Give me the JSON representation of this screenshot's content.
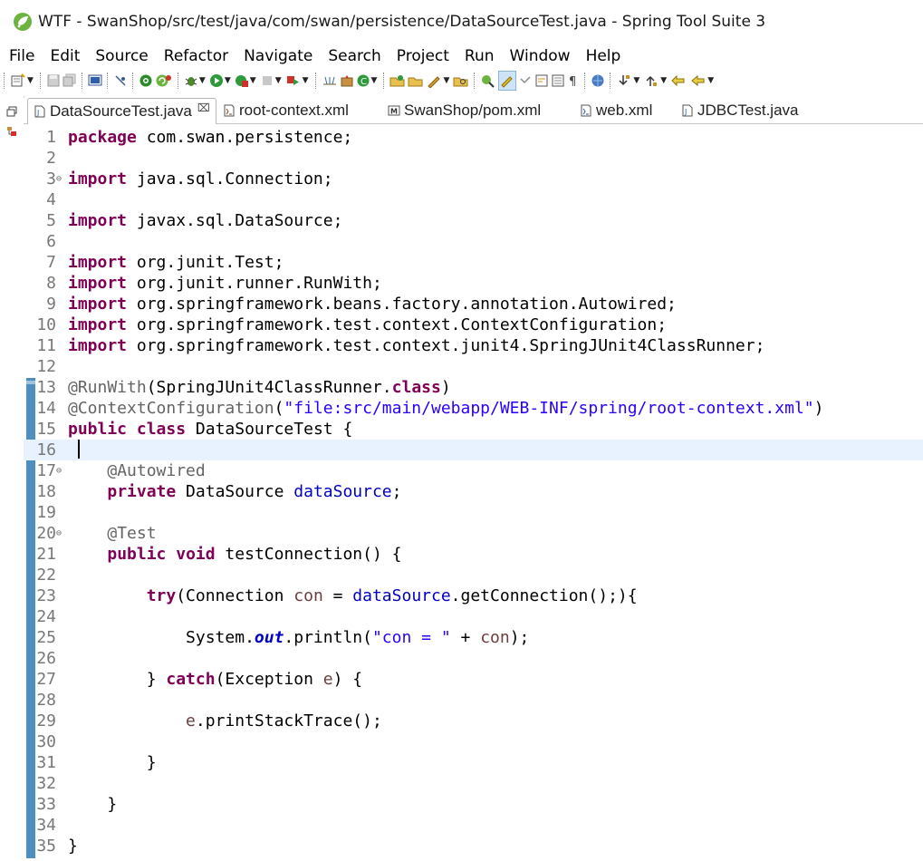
{
  "window": {
    "title": "WTF - SwanShop/src/test/java/com/swan/persistence/DataSourceTest.java - Spring Tool Suite 3"
  },
  "menu": [
    "File",
    "Edit",
    "Source",
    "Refactor",
    "Navigate",
    "Search",
    "Project",
    "Run",
    "Window",
    "Help"
  ],
  "tabs": [
    {
      "label": "DataSourceTest.java",
      "close": "⌧",
      "icon": "java-file-icon",
      "active": true
    },
    {
      "label": "root-context.xml",
      "icon": "xml-file-icon",
      "active": false
    },
    {
      "label": "SwanShop/pom.xml",
      "icon": "maven-pom-icon",
      "active": false
    },
    {
      "label": "web.xml",
      "icon": "xml-file-icon",
      "active": false
    },
    {
      "label": "JDBCTest.java",
      "icon": "java-file-icon",
      "active": false
    }
  ],
  "editor": {
    "current_line": 16,
    "lines": [
      {
        "n": "1",
        "t": [
          [
            "kw",
            "package"
          ],
          [
            "",
            "com.swan.persistence;"
          ]
        ]
      },
      {
        "n": "2",
        "t": []
      },
      {
        "n": "3",
        "fold": "⊖",
        "t": [
          [
            "kw",
            "import"
          ],
          [
            "",
            " java.sql.Connection;"
          ]
        ]
      },
      {
        "n": "4",
        "t": []
      },
      {
        "n": "5",
        "t": [
          [
            "kw",
            "import"
          ],
          [
            "",
            " javax.sql.DataSource;"
          ]
        ]
      },
      {
        "n": "6",
        "t": []
      },
      {
        "n": "7",
        "t": [
          [
            "kw",
            "import"
          ],
          [
            "",
            " org.junit.Test;"
          ]
        ]
      },
      {
        "n": "8",
        "t": [
          [
            "kw",
            "import"
          ],
          [
            "",
            " org.junit.runner.RunWith;"
          ]
        ]
      },
      {
        "n": "9",
        "t": [
          [
            "kw",
            "import"
          ],
          [
            "",
            " org.springframework.beans.factory.annotation.Autowired;"
          ]
        ]
      },
      {
        "n": "10",
        "t": [
          [
            "kw",
            "import"
          ],
          [
            "",
            " org.springframework.test.context.ContextConfiguration;"
          ]
        ]
      },
      {
        "n": "11",
        "t": [
          [
            "kw",
            "import"
          ],
          [
            "",
            " org.springframework.test.context.junit4.SpringJUnit4ClassRunner;"
          ]
        ]
      },
      {
        "n": "12",
        "t": []
      },
      {
        "n": "13",
        "t": [
          [
            "ann",
            "@RunWith"
          ],
          [
            "",
            "(SpringJUnit4ClassRunner."
          ],
          [
            "kw",
            "class"
          ],
          [
            "",
            ")"
          ]
        ]
      },
      {
        "n": "14",
        "t": [
          [
            "ann",
            "@ContextConfiguration"
          ],
          [
            "",
            "("
          ],
          [
            "str",
            "\"file:src/main/webapp/WEB-INF/spring/root-context.xml\""
          ],
          [
            "",
            ")"
          ]
        ]
      },
      {
        "n": "15",
        "t": [
          [
            "kw",
            "public"
          ],
          [
            "",
            " "
          ],
          [
            "kw",
            "class"
          ],
          [
            "",
            " DataSourceTest {"
          ]
        ]
      },
      {
        "n": "16",
        "t": []
      },
      {
        "n": "17",
        "fold": "⊖",
        "t": [
          [
            "",
            "    "
          ],
          [
            "ann",
            "@Autowired"
          ]
        ]
      },
      {
        "n": "18",
        "t": [
          [
            "",
            "    "
          ],
          [
            "kw",
            "private"
          ],
          [
            "",
            " DataSource "
          ],
          [
            "fld",
            "dataSource"
          ],
          [
            "",
            ";"
          ]
        ]
      },
      {
        "n": "19",
        "t": []
      },
      {
        "n": "20",
        "fold": "⊖",
        "t": [
          [
            "",
            "    "
          ],
          [
            "ann",
            "@Test"
          ]
        ]
      },
      {
        "n": "21",
        "t": [
          [
            "",
            "    "
          ],
          [
            "kw",
            "public"
          ],
          [
            "",
            " "
          ],
          [
            "kw",
            "void"
          ],
          [
            "",
            " testConnection() {"
          ]
        ]
      },
      {
        "n": "22",
        "t": []
      },
      {
        "n": "23",
        "t": [
          [
            "",
            "        "
          ],
          [
            "kw",
            "try"
          ],
          [
            "",
            "(Connection "
          ],
          [
            "loc",
            "con"
          ],
          [
            "",
            " = "
          ],
          [
            "fld",
            "dataSource"
          ],
          [
            "",
            ".getConnection();){"
          ]
        ]
      },
      {
        "n": "24",
        "t": []
      },
      {
        "n": "25",
        "t": [
          [
            "",
            "            System."
          ],
          [
            "sfld",
            "out"
          ],
          [
            "",
            ".println("
          ],
          [
            "str",
            "\"con = \""
          ],
          [
            "",
            " + "
          ],
          [
            "loc",
            "con"
          ],
          [
            "",
            ");"
          ]
        ]
      },
      {
        "n": "26",
        "t": []
      },
      {
        "n": "27",
        "t": [
          [
            "",
            "        } "
          ],
          [
            "kw",
            "catch"
          ],
          [
            "",
            "(Exception "
          ],
          [
            "loc",
            "e"
          ],
          [
            "",
            ") {"
          ]
        ]
      },
      {
        "n": "28",
        "t": []
      },
      {
        "n": "29",
        "t": [
          [
            "",
            "            "
          ],
          [
            "loc",
            "e"
          ],
          [
            "",
            ".printStackTrace();"
          ]
        ]
      },
      {
        "n": "30",
        "t": []
      },
      {
        "n": "31",
        "t": [
          [
            "",
            "        }"
          ]
        ]
      },
      {
        "n": "32",
        "t": []
      },
      {
        "n": "33",
        "t": [
          [
            "",
            "    }"
          ]
        ]
      },
      {
        "n": "34",
        "t": []
      },
      {
        "n": "35",
        "t": [
          [
            "",
            "}"
          ]
        ]
      }
    ]
  }
}
